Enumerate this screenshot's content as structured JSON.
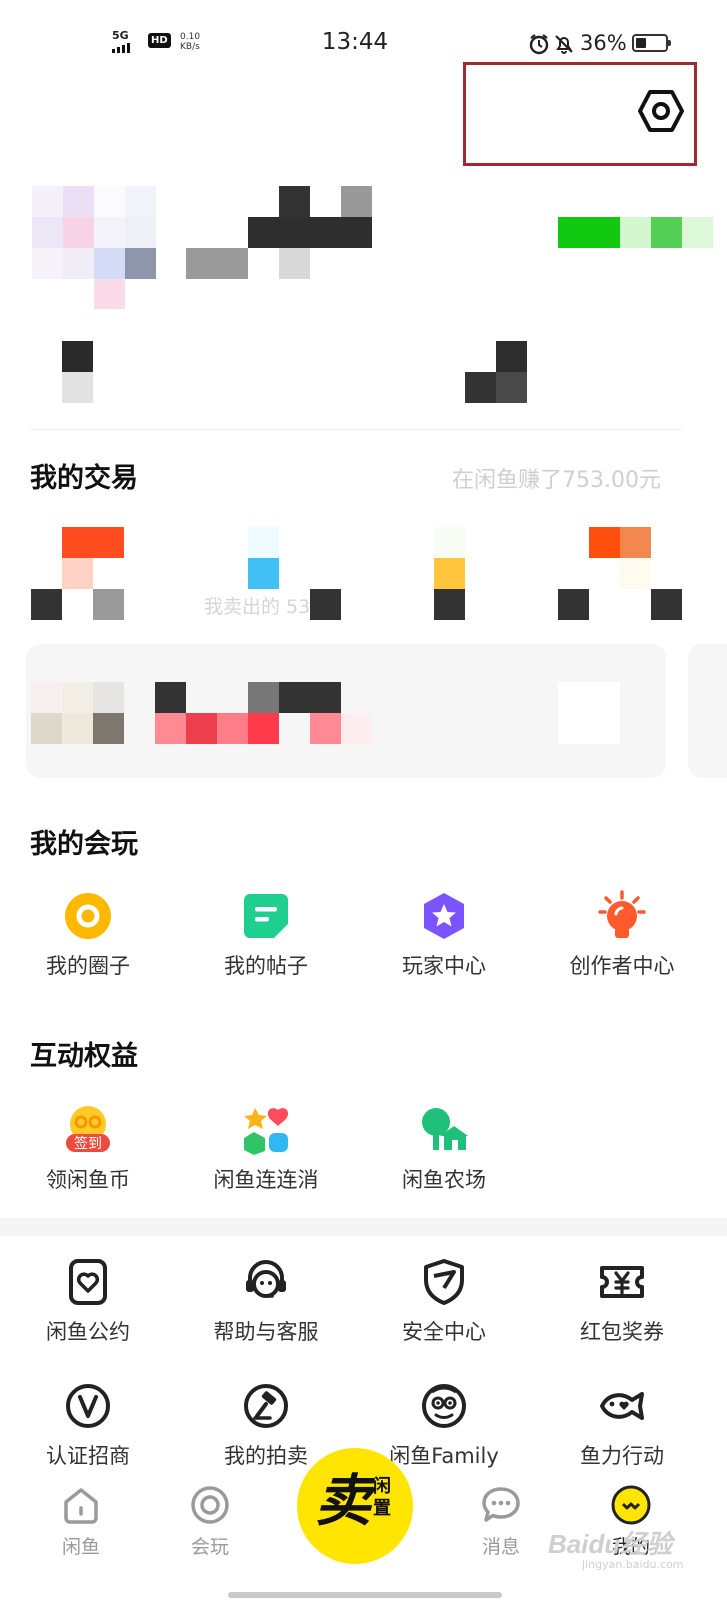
{
  "status_bar": {
    "network": "5G",
    "hd": "HD",
    "speed_value": "0.10",
    "speed_unit": "KB/s",
    "time": "13:44",
    "battery": "36%",
    "battery_level": 0.36
  },
  "trade": {
    "title": "我的交易",
    "earnings": "在闲鱼赚了753.00元",
    "sold_text": "我卖出的 53"
  },
  "huiwan": {
    "title": "我的会玩",
    "items": [
      {
        "label": "我的圈子",
        "icon": "circle-icon",
        "color": "#ffb800"
      },
      {
        "label": "我的帖子",
        "icon": "post-icon",
        "color": "#1fcf8f"
      },
      {
        "label": "玩家中心",
        "icon": "star-badge-icon",
        "color": "#7b53ff"
      },
      {
        "label": "创作者中心",
        "icon": "bulb-icon",
        "color": "#ff5a2c"
      }
    ]
  },
  "benefits": {
    "title": "互动权益",
    "items": [
      {
        "label": "领闲鱼币",
        "icon": "checkin-coin-icon",
        "badge": "签到"
      },
      {
        "label": "闲鱼连连消",
        "icon": "match-game-icon"
      },
      {
        "label": "闲鱼农场",
        "icon": "farm-icon"
      }
    ]
  },
  "services": {
    "row1": [
      {
        "label": "闲鱼公约",
        "icon": "convention-icon"
      },
      {
        "label": "帮助与客服",
        "icon": "support-icon"
      },
      {
        "label": "安全中心",
        "icon": "shield-icon"
      },
      {
        "label": "红包奖券",
        "icon": "coupon-icon"
      }
    ],
    "row2": [
      {
        "label": "认证招商",
        "icon": "verified-icon"
      },
      {
        "label": "我的拍卖",
        "icon": "auction-icon"
      },
      {
        "label": "闲鱼Family",
        "icon": "family-icon"
      },
      {
        "label": "鱼力行动",
        "icon": "fish-heart-icon"
      }
    ]
  },
  "tabbar": {
    "tabs": [
      {
        "label": "闲鱼",
        "icon": "home-icon"
      },
      {
        "label": "会玩",
        "icon": "ring-icon"
      },
      {
        "label": "消息",
        "icon": "message-icon"
      },
      {
        "label": "我的",
        "icon": "face-icon"
      }
    ],
    "sell_big": "卖",
    "sell_small": "闲置"
  },
  "colors": {
    "brand_yellow": "#ffe500",
    "highlight_border": "#9e2a33"
  },
  "watermark": {
    "text": "Baidu经验",
    "sub": "jingyan.baidu.com"
  }
}
